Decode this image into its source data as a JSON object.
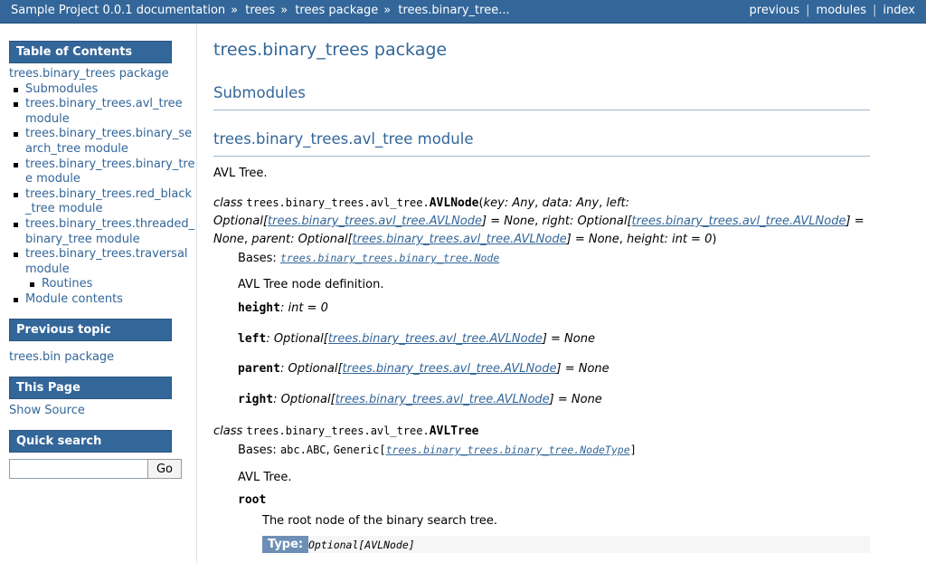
{
  "topbar": {
    "crumbs": [
      "Sample Project 0.0.1 documentation",
      "trees",
      "trees package",
      "trees.binary_tree..."
    ],
    "sep": "»",
    "right": [
      "previous",
      "modules",
      "index"
    ],
    "bar_sep": "|"
  },
  "sidebar": {
    "toc_title": "Table of Contents",
    "toc_root": "trees.binary_trees package",
    "toc_items": [
      "Submodules",
      "trees.binary_trees.avl_tree module",
      "trees.binary_trees.binary_search_tree module",
      "trees.binary_trees.binary_tree module",
      "trees.binary_trees.red_black_tree module",
      "trees.binary_trees.threaded_binary_tree module",
      "trees.binary_trees.traversal module"
    ],
    "toc_sub": "Routines",
    "toc_last": "Module contents",
    "prev_title": "Previous topic",
    "prev_link": "trees.bin package",
    "page_title": "This Page",
    "page_link": "Show Source",
    "search_title": "Quick search",
    "search_value": "",
    "search_button": "Go"
  },
  "main": {
    "h1": "trees.binary_trees package",
    "h2_sub": "Submodules",
    "h2_mod": "trees.binary_trees.avl_tree module",
    "mod_desc": "AVL Tree.",
    "node": {
      "kw": "class",
      "prefix": "trees.binary_trees.avl_tree.",
      "name": "AVLNode",
      "p_key": "key",
      "t_key": ": Any",
      "p_data": "data",
      "t_data": ": Any",
      "p_left": "left",
      "t_opt": ": Optional[",
      "link": "trees.binary_trees.avl_tree.AVLNode",
      "close_none": "] = None",
      "p_right": "right",
      "p_parent": "parent",
      "opt_plain": "Optional[",
      "p_height": "height",
      "t_height": ": int = 0",
      "bases_label": "Bases: ",
      "bases_link": "trees.binary_trees.binary_tree.Node",
      "desc": "AVL Tree node definition.",
      "attrs": [
        {
          "name": "height",
          "rest": ": int = 0",
          "link": "",
          "tail": ""
        },
        {
          "name": "left",
          "rest": ": Optional[",
          "link": "trees.binary_trees.avl_tree.AVLNode",
          "tail": "] = None"
        },
        {
          "name": "parent",
          "rest": ": Optional[",
          "link": "trees.binary_trees.avl_tree.AVLNode",
          "tail": "] = None"
        },
        {
          "name": "right",
          "rest": ": Optional[",
          "link": "trees.binary_trees.avl_tree.AVLNode",
          "tail": "] = None"
        }
      ]
    },
    "tree": {
      "kw": "class",
      "prefix": "trees.binary_trees.avl_tree.",
      "name": "AVLTree",
      "bases_label": "Bases: ",
      "bases_abc": "abc.ABC",
      "bases_generic": "Generic[",
      "bases_link": "trees.binary_trees.binary_tree.NodeType",
      "bases_close": "]",
      "desc": "AVL Tree.",
      "attr_name": "root",
      "attr_desc": "The root node of the binary search tree.",
      "type_label": "Type:",
      "type_value": "Optional[AVLNode]"
    }
  }
}
